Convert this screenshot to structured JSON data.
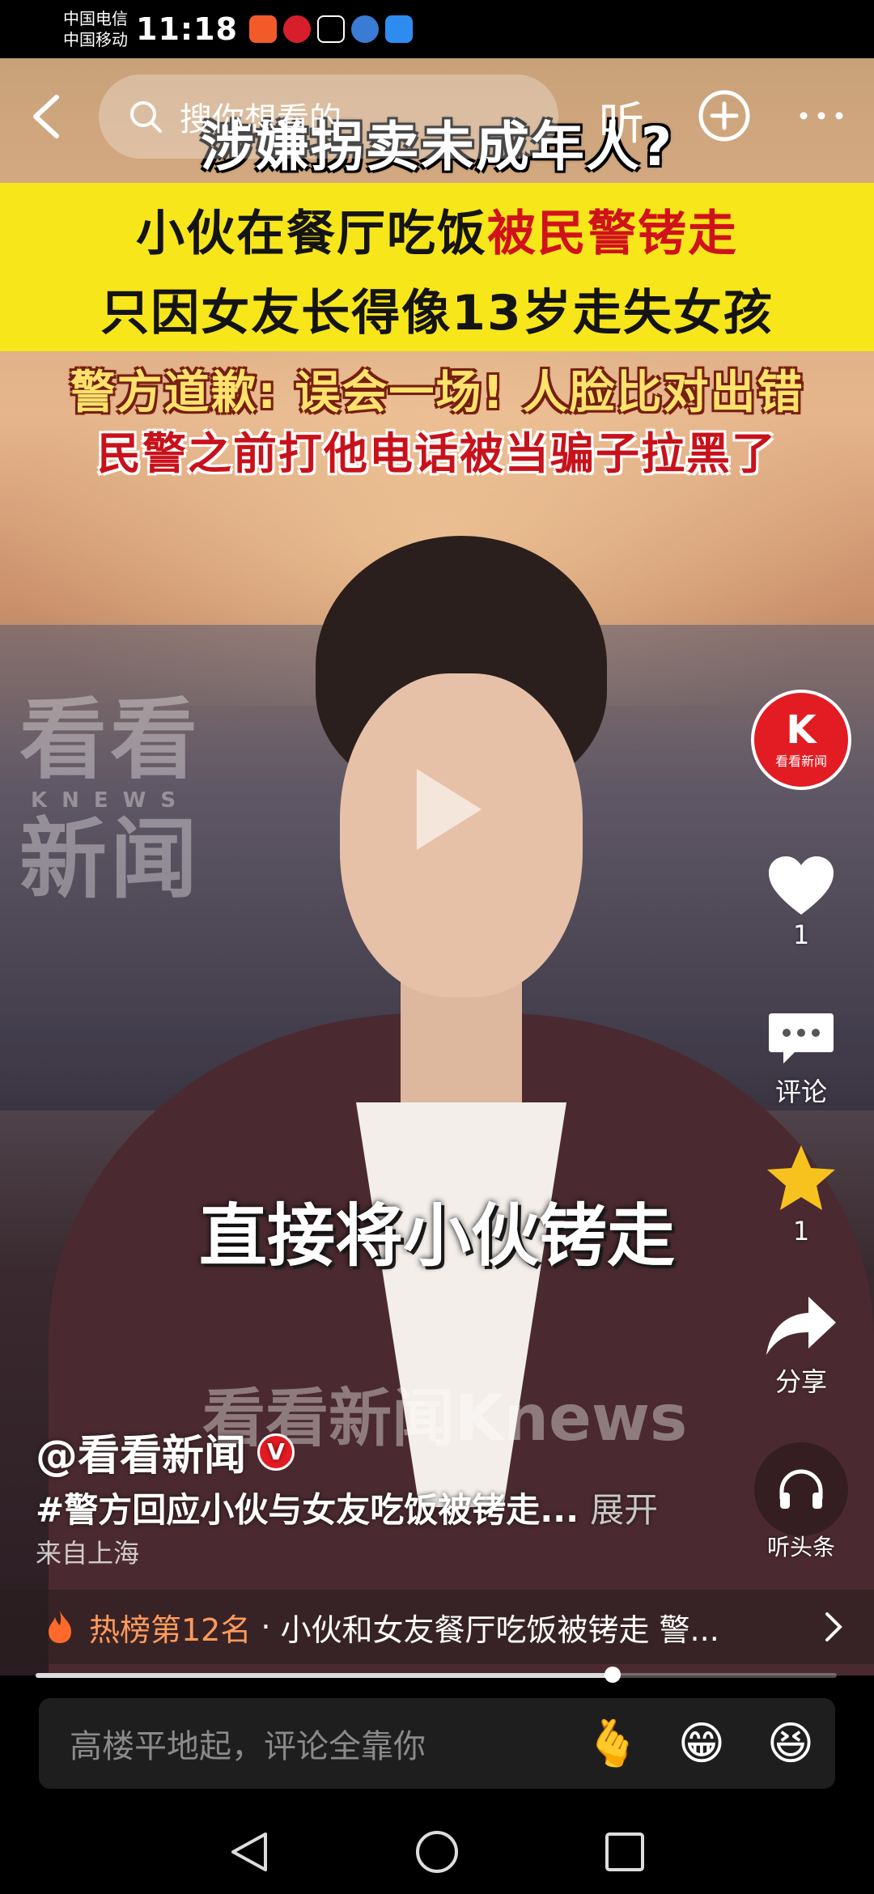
{
  "status_bar": {
    "carrier1": "中国电信",
    "carrier2": "中国移动",
    "time": "11:18",
    "app_icons": [
      "taobao-icon",
      "unionpay-icon",
      "app-icon",
      "browser-icon",
      "weather-icon"
    ]
  },
  "top_bar": {
    "search_placeholder": "搜你想看的",
    "listen_label": "听"
  },
  "video": {
    "headline1": "涉嫌拐卖未成年人?",
    "headline2_black": "小伙在餐厅吃饭",
    "headline2_red": "被民警铐走",
    "headline3": "只因女友长得像13岁走失女孩",
    "headline4": "警方道歉: 误会一场! 人脸比对出错",
    "headline5": "民警之前打他电话被当骗子拉黑了",
    "subtitle": "直接将小伙铐走",
    "watermark_big1": "看看",
    "watermark_small": "KNEWS",
    "watermark_big2": "新闻",
    "watermark_bottom": "看看新闻Knews"
  },
  "rail": {
    "avatar_k": "K",
    "avatar_text": "看看新闻",
    "like_count": "1",
    "comment_label": "评论",
    "favorite_count": "1",
    "share_label": "分享",
    "listen_headline_label": "听头条"
  },
  "post": {
    "author": "@看看新闻",
    "verified_mark": "V",
    "description": "#警方回应小伙与女友吃饭被铐走...",
    "expand_label": "展开",
    "origin": "来自上海"
  },
  "hot": {
    "rank": "热榜第12名",
    "separator": "·",
    "text": "小伙和女友餐厅吃饭被铐走 警..."
  },
  "playback": {
    "progress_fraction": 0.72
  },
  "comment_bar": {
    "placeholder": "高楼平地起，评论全靠你",
    "emojis": [
      "🫰",
      "😁",
      "😆"
    ]
  },
  "colors": {
    "brand_red": "#e31b23",
    "hot_orange": "#ff9a5c",
    "band_yellow": "#f7e61a"
  }
}
